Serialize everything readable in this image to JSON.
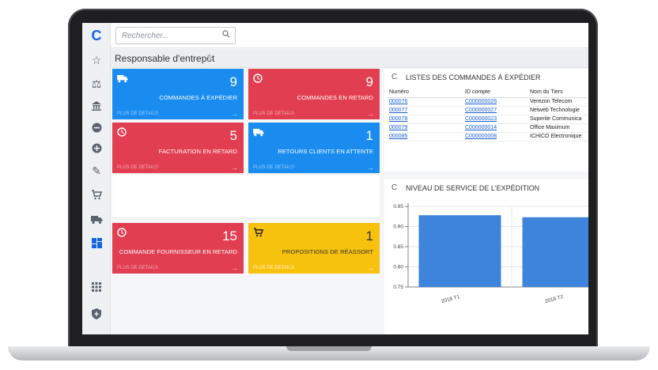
{
  "search": {
    "placeholder": "Rechercher..."
  },
  "page": {
    "title": "Responsable d'entrepôt"
  },
  "sidebar": {
    "items": [
      {
        "icon": "logo",
        "glyph": "C"
      },
      {
        "icon": "star-icon",
        "glyph": "☆"
      },
      {
        "icon": "balance-icon",
        "glyph": "⚖"
      },
      {
        "icon": "bank-icon",
        "glyph": "🏛"
      },
      {
        "icon": "minus-circle-icon",
        "glyph": "⊖"
      },
      {
        "icon": "plus-circle-icon",
        "glyph": "⊕"
      },
      {
        "icon": "edit-icon",
        "glyph": "✎"
      },
      {
        "icon": "cart-icon",
        "glyph": "🛒"
      },
      {
        "icon": "truck-icon",
        "glyph": "🚚"
      },
      {
        "icon": "dashboard-icon",
        "glyph": "▦"
      },
      {
        "icon": "apps-icon",
        "glyph": "⋮⋮⋮"
      },
      {
        "icon": "shield-icon",
        "glyph": "⛨"
      }
    ]
  },
  "tiles": [
    {
      "label": "COMMANDES À EXPÉDIER",
      "count": "9",
      "more": "PLUS DE DÉTAILS",
      "color": "#1a8cf0",
      "icon": "truck-icon"
    },
    {
      "label": "COMMANDES EN RETARD",
      "count": "9",
      "more": "PLUS DE DÉTAILS",
      "color": "#e23e51",
      "icon": "clock-icon"
    },
    {
      "label": "FACTURATION EN RETARD",
      "count": "5",
      "more": "PLUS DE DÉTAILS",
      "color": "#e23e51",
      "icon": "clock-icon"
    },
    {
      "label": "RETOURS CLIENTS EN ATTENTE",
      "count": "1",
      "more": "PLUS DE DÉTAILS",
      "color": "#1a8cf0",
      "icon": "truck-icon"
    },
    {
      "label": "COMMANDE FOURNISSEUR EN RETARD",
      "count": "15",
      "more": "PLUS DE DÉTAILS",
      "color": "#e23e51",
      "icon": "clock-icon"
    },
    {
      "label": "PROPOSITIONS DE RÉASSORT",
      "count": "1",
      "more": "PLUS DE DÉTAILS",
      "color": "#f7c20e",
      "icon": "cart-icon"
    }
  ],
  "orders_panel": {
    "title": "LISTES DES COMMANDES À EXPÉDIER",
    "columns": [
      "Numéro",
      "ID compte",
      "Nom du Tiers"
    ],
    "rows": [
      [
        "000076",
        "C000000026",
        "Verezon Telecom"
      ],
      [
        "000077",
        "C000000027",
        "Netweb Technologie"
      ],
      [
        "000078",
        "C000000023",
        "Superite Communica"
      ],
      [
        "000079",
        "C000000014",
        "Office Maximum"
      ],
      [
        "000085",
        "C000000008",
        "ICHICO Electronique"
      ]
    ]
  },
  "chart_panel": {
    "title": "NIVEAU DE SERVICE DE L'EXPÉDITION"
  },
  "chart_data": {
    "type": "bar",
    "categories": [
      "2018 T1",
      "2018 T2"
    ],
    "values": [
      0.928,
      0.923
    ],
    "ylim": [
      0.75,
      0.95
    ],
    "yticks": [
      "0.95",
      "0.90",
      "0.85",
      "0.80",
      "0.75"
    ],
    "bar_color": "#3f84dc",
    "grid": true
  }
}
